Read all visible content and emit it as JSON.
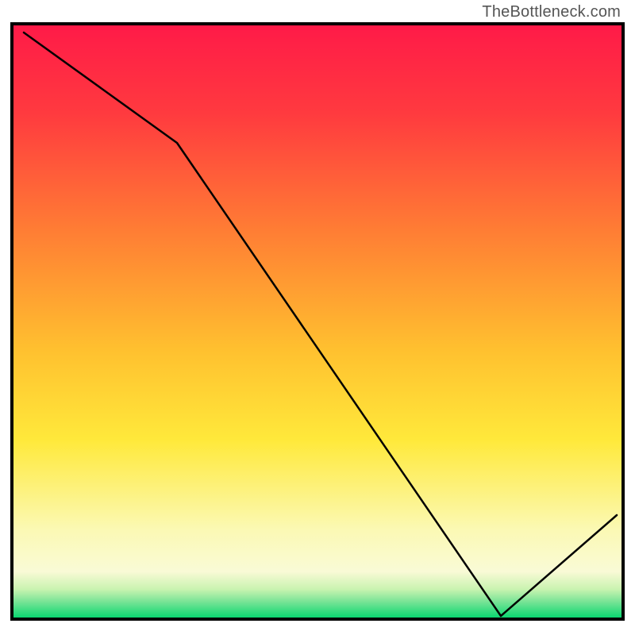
{
  "attribution": "TheBottleneck.com",
  "colors": {
    "frame": "#000000",
    "line": "#000000",
    "gradient_top": "#ff1846",
    "gradient_mid_orange": "#ff8f2f",
    "gradient_yellow": "#ffe93b",
    "gradient_pale": "#fcfcd2",
    "gradient_green": "#00d66d"
  },
  "chart_data": {
    "type": "line",
    "title": "",
    "xlabel": "",
    "ylabel": "",
    "x": [
      0.02,
      0.27,
      0.8,
      0.99
    ],
    "values": [
      0.985,
      0.8,
      0.005,
      0.175
    ],
    "xlim": [
      0,
      1
    ],
    "ylim": [
      0,
      1
    ],
    "grid": false,
    "notes": "Axes unlabeled; values are normalized [0,1] readings. Line descends from upper-left, inflects near x≈0.27, reaches minimum near x≈0.80, then rises toward right edge."
  }
}
